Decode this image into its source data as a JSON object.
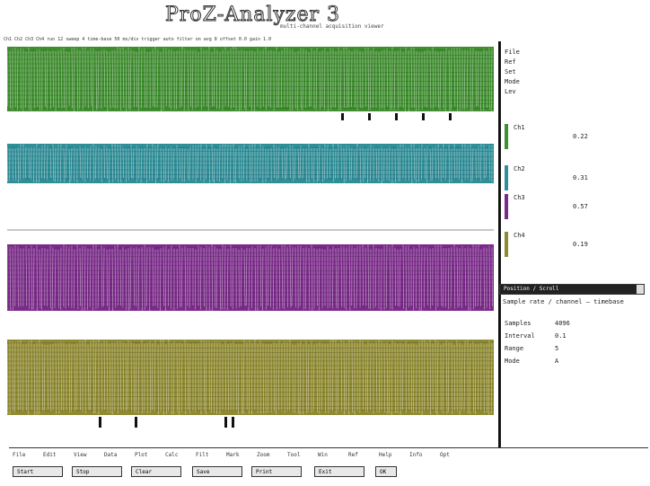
{
  "window": {
    "title": "ProZ-Analyzer 3",
    "subtitle": "multi-channel acquisition viewer",
    "top_strip_text": "Ch1 Ch2 Ch3 Ch4  run 12  sweep 4  time-base 50 ms/div  trigger auto  filter on  avg 8  offset 0.0  gain 1.0"
  },
  "colors": {
    "channel1": "#3f8f2f",
    "channel2": "#2f8f99",
    "channel3": "#7b2a8a",
    "channel4": "#8f8a2f",
    "panel_bg": "#ffffff",
    "ink": "#222222"
  },
  "channels": [
    {
      "name": "Ch 1"
    },
    {
      "name": "Ch 2"
    },
    {
      "name": "Ch 3"
    },
    {
      "name": "Ch 4"
    }
  ],
  "sidebar": {
    "header_items": [
      "File",
      "Ref",
      "Set",
      "Mode",
      "Lev"
    ],
    "channel_readouts": [
      {
        "label": "Ch1",
        "value": "0.22"
      },
      {
        "label": "Ch2",
        "value": "0.31"
      },
      {
        "label": "Ch3",
        "value": "0.57"
      },
      {
        "label": "Ch4",
        "value": "0.19"
      }
    ],
    "status": {
      "label": "Sample rate / channel — timebase",
      "readouts": [
        {
          "label": "Samples",
          "value": "4096"
        },
        {
          "label": "Interval",
          "value": "0.1"
        },
        {
          "label": "Range",
          "value": "5"
        },
        {
          "label": "Mode",
          "value": "A"
        }
      ]
    },
    "slider_label": "Position / Scroll",
    "slider_level": 0.95
  },
  "bottombar": {
    "tabs": [
      "File",
      "Edit",
      "View",
      "Data",
      "Plot",
      "Calc",
      "Filt",
      "Mark",
      "Zoom",
      "Tool",
      "Win",
      "Ref",
      "Help",
      "Info",
      "Opt"
    ],
    "buttons": [
      "Start",
      "Stop",
      "Clear",
      "Save",
      "Print",
      "Exit",
      "OK"
    ]
  }
}
